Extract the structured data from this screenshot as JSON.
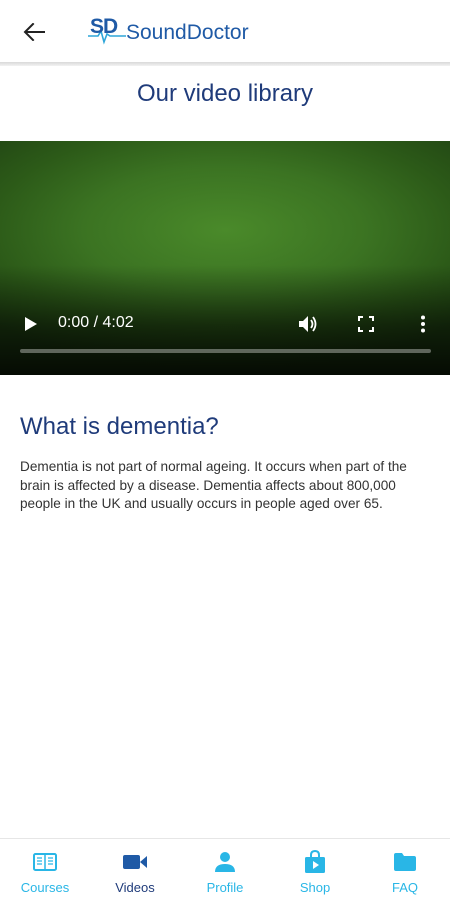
{
  "header": {
    "logo_initials": "SD",
    "logo_name_part1": "Sound",
    "logo_name_part2": "Doctor",
    "back_icon": "arrow-left-icon"
  },
  "page": {
    "title": "Our video library"
  },
  "video_player": {
    "time_display": "0:00 / 4:02",
    "progress": 0.0,
    "play_icon": "play-icon",
    "volume_icon": "volume-icon",
    "fullscreen_icon": "fullscreen-icon",
    "more_icon": "more-vertical-icon"
  },
  "article": {
    "heading": "What is dementia?",
    "body": "Dementia is not part of normal ageing. It occurs when part of the brain is affected by a disease. Dementia affects about 800,000 people in the UK and usually occurs in people aged over 65."
  },
  "bottom_nav": {
    "items": [
      {
        "label": "Courses",
        "icon": "courses-icon",
        "active": false
      },
      {
        "label": "Videos",
        "icon": "video-camera-icon",
        "active": true
      },
      {
        "label": "Profile",
        "icon": "person-icon",
        "active": false
      },
      {
        "label": "Shop",
        "icon": "shop-bag-icon",
        "active": false
      },
      {
        "label": "FAQ",
        "icon": "folder-icon",
        "active": false
      }
    ]
  },
  "colors": {
    "brand_dark_blue": "#1f3b7a",
    "brand_blue": "#1f5aa6",
    "accent_cyan": "#29b6e6",
    "active_nav": "#1f5aa6"
  }
}
